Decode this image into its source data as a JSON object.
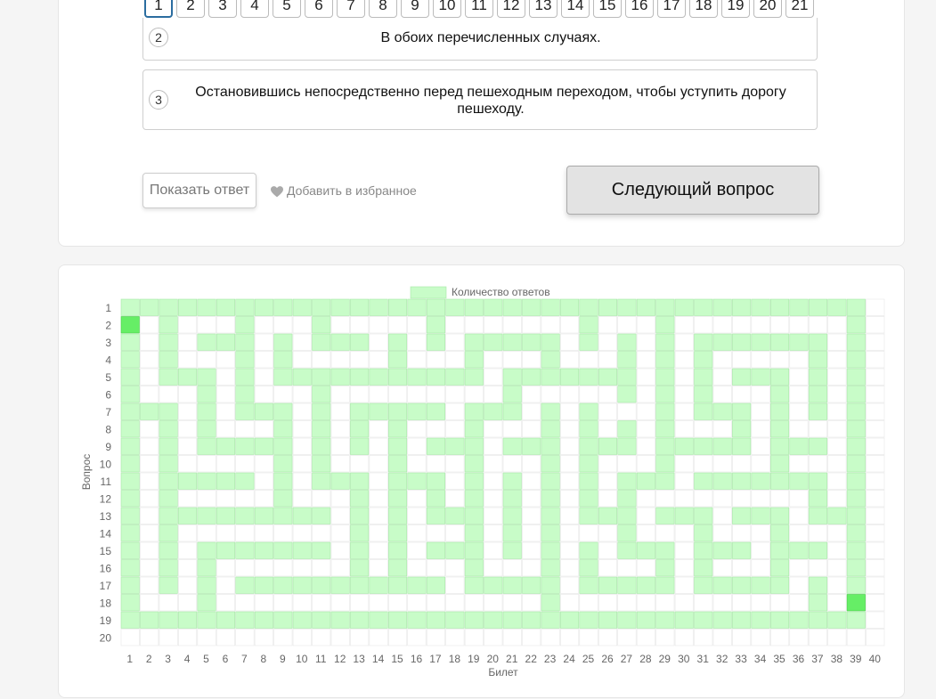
{
  "question_tabs": [
    "1",
    "2",
    "3",
    "4",
    "5",
    "6",
    "7",
    "8",
    "9",
    "10",
    "11",
    "12",
    "13",
    "14",
    "15",
    "16",
    "17",
    "18",
    "19",
    "20",
    "21"
  ],
  "active_tab": "1",
  "answers": [
    {
      "number": "2",
      "text": "В обоих перечисленных случаях."
    },
    {
      "number": "3",
      "text": "Остановившись непосредственно перед пешеходным переходом, чтобы уступить дорогу пешеходу."
    }
  ],
  "buttons": {
    "show_answer": "Показать ответ",
    "favorite": "Добавить в избранное",
    "favorite_icon": "heart-icon",
    "next": "Следующий вопрос"
  },
  "chart_data": {
    "type": "heatmap",
    "legend": "Количество ответов",
    "legend_placement": "top",
    "xlabel": "Билет",
    "ylabel": "Вопрос",
    "x_categories": [
      "1",
      "2",
      "3",
      "4",
      "5",
      "6",
      "7",
      "8",
      "9",
      "10",
      "11",
      "12",
      "13",
      "14",
      "15",
      "16",
      "17",
      "18",
      "19",
      "20",
      "21",
      "22",
      "23",
      "24",
      "25",
      "26",
      "27",
      "28",
      "29",
      "30",
      "31",
      "32",
      "33",
      "34",
      "35",
      "36",
      "37",
      "38",
      "39",
      "40"
    ],
    "y_categories": [
      "1",
      "2",
      "3",
      "4",
      "5",
      "6",
      "7",
      "8",
      "9",
      "10",
      "11",
      "12",
      "13",
      "14",
      "15",
      "16",
      "17",
      "18",
      "19",
      "20"
    ],
    "colors": {
      "light": "#c8fcc8",
      "dark": "#66ee66",
      "empty": "#ffffff",
      "grid": "#e2e2e2"
    },
    "values": [
      [
        1,
        1,
        1,
        1,
        1,
        1,
        1,
        1,
        1,
        1,
        1,
        1,
        1,
        1,
        1,
        1,
        1,
        1,
        1,
        1,
        1,
        1,
        1,
        1,
        1,
        1,
        1,
        1,
        1,
        1,
        1,
        1,
        1,
        1,
        1,
        1,
        1,
        1,
        1,
        0
      ],
      [
        2,
        0,
        1,
        0,
        0,
        0,
        1,
        0,
        0,
        0,
        1,
        0,
        0,
        0,
        0,
        0,
        1,
        0,
        0,
        0,
        0,
        0,
        0,
        0,
        1,
        0,
        0,
        0,
        1,
        0,
        0,
        0,
        0,
        0,
        0,
        0,
        0,
        0,
        1,
        0
      ],
      [
        1,
        0,
        1,
        0,
        1,
        1,
        1,
        0,
        1,
        0,
        1,
        1,
        1,
        0,
        1,
        0,
        1,
        0,
        1,
        1,
        1,
        1,
        1,
        0,
        1,
        0,
        1,
        0,
        1,
        0,
        1,
        1,
        1,
        1,
        1,
        1,
        1,
        0,
        1,
        0
      ],
      [
        1,
        0,
        1,
        0,
        0,
        0,
        1,
        0,
        1,
        0,
        0,
        0,
        0,
        0,
        1,
        0,
        0,
        0,
        1,
        0,
        0,
        0,
        1,
        0,
        0,
        0,
        1,
        0,
        1,
        0,
        1,
        0,
        0,
        0,
        0,
        0,
        1,
        0,
        1,
        0
      ],
      [
        1,
        0,
        1,
        1,
        1,
        0,
        1,
        0,
        1,
        1,
        1,
        1,
        1,
        1,
        1,
        1,
        1,
        1,
        1,
        0,
        1,
        1,
        1,
        1,
        1,
        1,
        1,
        0,
        1,
        0,
        1,
        0,
        1,
        1,
        1,
        0,
        1,
        0,
        1,
        0
      ],
      [
        1,
        0,
        0,
        0,
        1,
        0,
        1,
        0,
        0,
        0,
        1,
        0,
        0,
        0,
        0,
        0,
        0,
        0,
        0,
        0,
        1,
        0,
        0,
        0,
        0,
        0,
        1,
        0,
        1,
        0,
        1,
        0,
        0,
        0,
        1,
        0,
        1,
        0,
        1,
        0
      ],
      [
        1,
        1,
        1,
        0,
        1,
        0,
        1,
        1,
        1,
        0,
        1,
        0,
        1,
        1,
        1,
        1,
        1,
        0,
        1,
        1,
        1,
        0,
        1,
        0,
        1,
        0,
        0,
        0,
        1,
        0,
        1,
        1,
        1,
        0,
        1,
        0,
        1,
        0,
        1,
        0
      ],
      [
        1,
        0,
        1,
        0,
        1,
        0,
        0,
        0,
        1,
        0,
        1,
        0,
        1,
        0,
        1,
        0,
        0,
        0,
        1,
        0,
        0,
        0,
        1,
        0,
        1,
        0,
        1,
        0,
        1,
        0,
        0,
        0,
        1,
        0,
        1,
        0,
        0,
        0,
        1,
        0
      ],
      [
        1,
        0,
        1,
        0,
        1,
        1,
        1,
        1,
        1,
        0,
        1,
        0,
        1,
        0,
        1,
        0,
        1,
        1,
        1,
        0,
        1,
        1,
        1,
        0,
        1,
        1,
        1,
        0,
        1,
        1,
        1,
        1,
        1,
        0,
        1,
        1,
        1,
        0,
        1,
        0
      ],
      [
        1,
        0,
        1,
        0,
        0,
        0,
        0,
        0,
        1,
        0,
        1,
        0,
        0,
        0,
        1,
        0,
        0,
        0,
        1,
        0,
        0,
        0,
        1,
        0,
        1,
        0,
        0,
        0,
        1,
        0,
        0,
        0,
        0,
        0,
        1,
        0,
        0,
        0,
        1,
        0
      ],
      [
        1,
        0,
        1,
        1,
        1,
        1,
        1,
        0,
        1,
        0,
        1,
        1,
        1,
        0,
        1,
        1,
        1,
        0,
        1,
        0,
        1,
        0,
        1,
        0,
        1,
        0,
        1,
        1,
        1,
        0,
        1,
        1,
        1,
        1,
        1,
        1,
        1,
        0,
        1,
        0
      ],
      [
        1,
        0,
        1,
        0,
        0,
        0,
        0,
        0,
        1,
        0,
        0,
        0,
        1,
        0,
        1,
        0,
        1,
        0,
        1,
        0,
        1,
        0,
        1,
        0,
        1,
        0,
        1,
        0,
        0,
        0,
        0,
        0,
        0,
        0,
        0,
        0,
        1,
        0,
        1,
        0
      ],
      [
        1,
        0,
        1,
        1,
        1,
        1,
        1,
        1,
        1,
        1,
        1,
        0,
        1,
        0,
        1,
        0,
        1,
        1,
        1,
        0,
        1,
        0,
        1,
        0,
        1,
        1,
        1,
        0,
        1,
        1,
        1,
        0,
        1,
        1,
        1,
        0,
        1,
        1,
        1,
        0
      ],
      [
        1,
        0,
        1,
        0,
        0,
        0,
        0,
        0,
        0,
        0,
        0,
        0,
        1,
        0,
        1,
        0,
        0,
        0,
        1,
        0,
        1,
        0,
        1,
        0,
        0,
        0,
        1,
        0,
        0,
        0,
        1,
        0,
        0,
        0,
        1,
        0,
        0,
        0,
        1,
        0
      ],
      [
        1,
        0,
        1,
        0,
        1,
        1,
        1,
        1,
        1,
        1,
        1,
        0,
        1,
        0,
        1,
        0,
        1,
        1,
        1,
        0,
        1,
        0,
        1,
        0,
        1,
        0,
        1,
        1,
        1,
        0,
        1,
        1,
        1,
        0,
        1,
        1,
        1,
        0,
        1,
        0
      ],
      [
        1,
        0,
        1,
        0,
        1,
        0,
        0,
        0,
        0,
        0,
        0,
        0,
        1,
        0,
        1,
        0,
        0,
        0,
        1,
        0,
        0,
        0,
        1,
        0,
        1,
        0,
        0,
        0,
        1,
        0,
        1,
        0,
        0,
        0,
        1,
        0,
        0,
        0,
        1,
        0
      ],
      [
        1,
        0,
        1,
        0,
        1,
        0,
        1,
        1,
        1,
        1,
        1,
        1,
        1,
        1,
        1,
        1,
        1,
        0,
        1,
        1,
        1,
        1,
        1,
        0,
        1,
        1,
        1,
        1,
        1,
        0,
        1,
        1,
        1,
        1,
        1,
        0,
        1,
        0,
        1,
        0
      ],
      [
        1,
        0,
        0,
        0,
        1,
        0,
        0,
        0,
        0,
        0,
        0,
        0,
        0,
        0,
        0,
        0,
        0,
        0,
        0,
        0,
        0,
        0,
        1,
        0,
        0,
        0,
        0,
        0,
        0,
        0,
        0,
        0,
        0,
        0,
        0,
        0,
        1,
        0,
        2,
        0
      ],
      [
        1,
        1,
        1,
        1,
        1,
        1,
        1,
        1,
        1,
        1,
        1,
        1,
        1,
        1,
        1,
        1,
        1,
        1,
        1,
        1,
        1,
        1,
        1,
        1,
        1,
        1,
        1,
        1,
        1,
        1,
        1,
        1,
        1,
        1,
        1,
        1,
        1,
        1,
        1,
        0
      ],
      [
        0,
        0,
        0,
        0,
        0,
        0,
        0,
        0,
        0,
        0,
        0,
        0,
        0,
        0,
        0,
        0,
        0,
        0,
        0,
        0,
        0,
        0,
        0,
        0,
        0,
        0,
        0,
        0,
        0,
        0,
        0,
        0,
        0,
        0,
        0,
        0,
        0,
        0,
        0,
        0
      ]
    ]
  }
}
